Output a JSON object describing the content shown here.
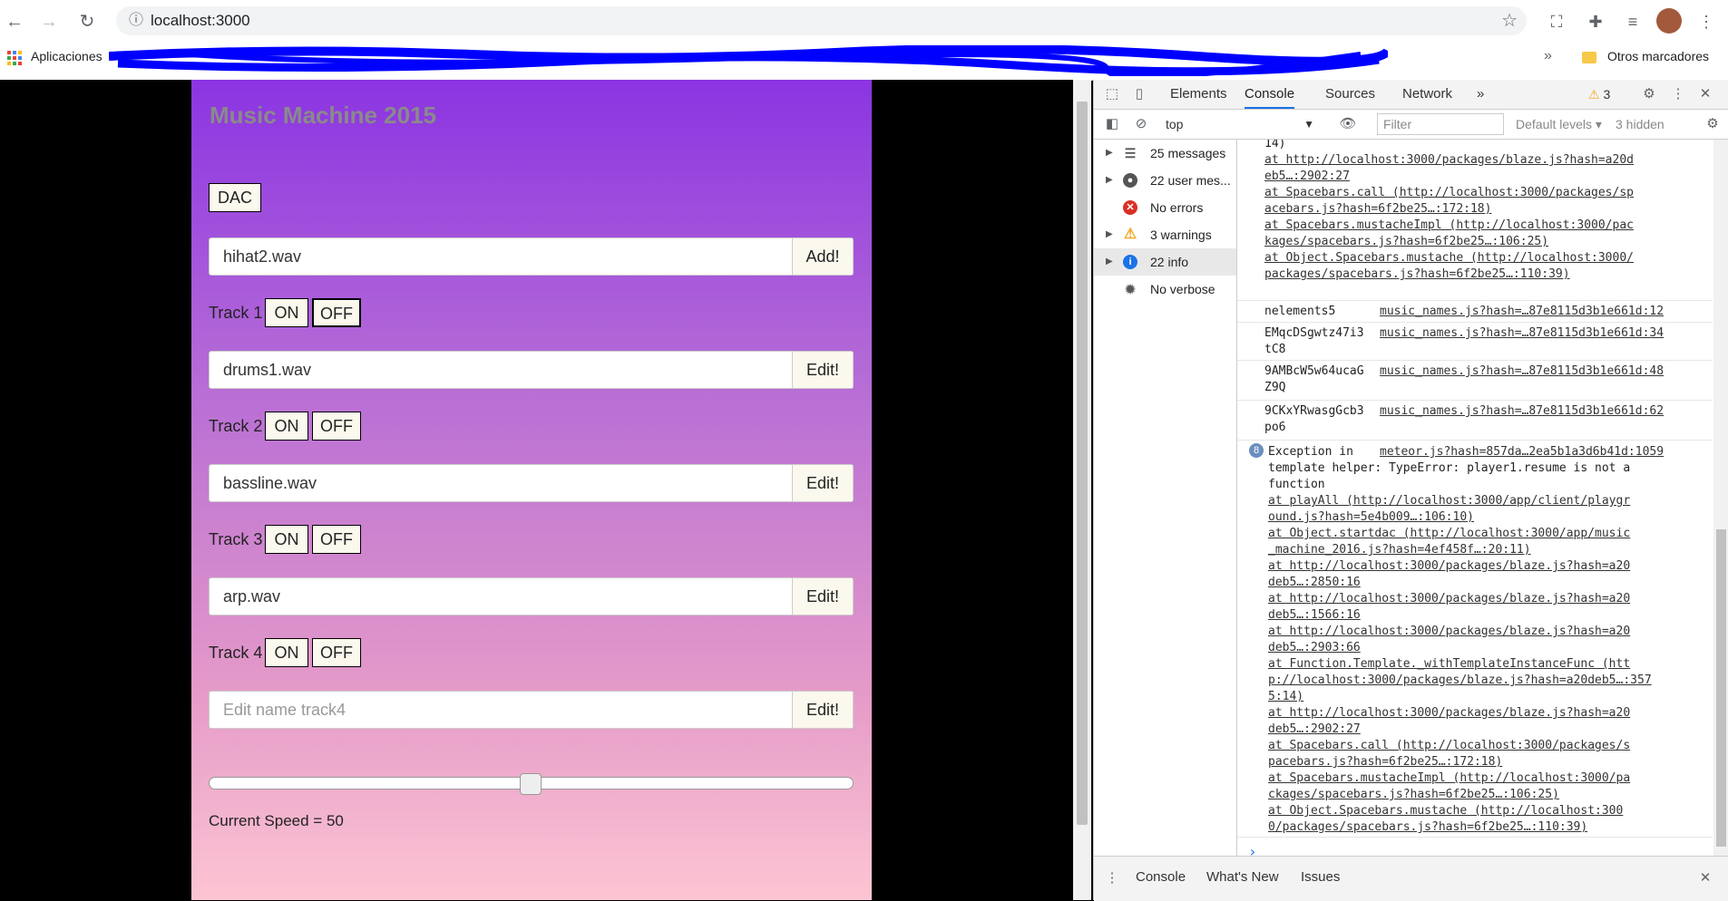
{
  "browser": {
    "url": "localhost:3000",
    "bookmarks": {
      "apps_label": "Aplicaciones",
      "more": "»",
      "other_label": "Otros marcadores"
    }
  },
  "app": {
    "title": "Music Machine 2015",
    "dac_label": "DAC",
    "rows": [
      {
        "input_value": "hihat2.wav",
        "placeholder": "",
        "action": "Add!"
      },
      {
        "input_value": "drums1.wav",
        "placeholder": "",
        "action": "Edit!"
      },
      {
        "input_value": "bassline.wav",
        "placeholder": "",
        "action": "Edit!"
      },
      {
        "input_value": "arp.wav",
        "placeholder": "",
        "action": "Edit!"
      },
      {
        "input_value": "",
        "placeholder": "Edit name track4",
        "action": "Edit!"
      }
    ],
    "tracks": [
      {
        "label": "Track 1",
        "on": "ON",
        "off": "OFF",
        "off_active": true
      },
      {
        "label": "Track 2",
        "on": "ON",
        "off": "OFF",
        "off_active": false
      },
      {
        "label": "Track 3",
        "on": "ON",
        "off": "OFF",
        "off_active": false
      },
      {
        "label": "Track 4",
        "on": "ON",
        "off": "OFF",
        "off_active": false
      }
    ],
    "speed_value": 50,
    "speed_text": "Current Speed = 50"
  },
  "devtools": {
    "tabs": [
      "Elements",
      "Console",
      "Sources",
      "Network"
    ],
    "active_tab": "Console",
    "more_tabs": "»",
    "warning_count": "3",
    "context": "top",
    "filter_placeholder": "Filter",
    "levels": "Default levels ▾",
    "hidden": "3 hidden",
    "sidebar": [
      {
        "label": "25 messages",
        "icon": "list-icon",
        "expandable": true
      },
      {
        "label": "22 user mes...",
        "icon": "user-icon",
        "expandable": true
      },
      {
        "label": "No errors",
        "icon": "error-icon",
        "expandable": false
      },
      {
        "label": "3 warnings",
        "icon": "warning-icon",
        "expandable": true
      },
      {
        "label": "22 info",
        "icon": "info-icon",
        "expandable": true
      },
      {
        "label": "No verbose",
        "icon": "bug-icon",
        "expandable": false
      }
    ],
    "console_top_lines": [
      "14)",
      "    at http://localhost:3000/packages/blaze.js?hash=a20d",
      "eb5…:2902:27",
      "    at Spacebars.call (http://localhost:3000/packages/sp",
      "acebars.js?hash=6f2be25…:172:18)",
      "    at Spacebars.mustacheImpl (http://localhost:3000/pac",
      "kages/spacebars.js?hash=6f2be25…:106:25)",
      "    at Object.Spacebars.mustache (http://localhost:3000/",
      "packages/spacebars.js?hash=6f2be25…:110:39)"
    ],
    "log_messages": [
      {
        "lines": [
          "nelements5"
        ],
        "source": "music_names.js?hash=…87e8115d3b1e661d:12"
      },
      {
        "lines": [
          "EMqcDSgwtz47i3",
          "tC8"
        ],
        "source": "music_names.js?hash=…87e8115d3b1e661d:34"
      },
      {
        "lines": [
          "9AMBcW5w64ucaG",
          "Z9Q"
        ],
        "source": "music_names.js?hash=…87e8115d3b1e661d:48"
      },
      {
        "lines": [
          "9CKxYRwasgGcb3",
          "po6"
        ],
        "source": "music_names.js?hash=…87e8115d3b1e661d:62"
      }
    ],
    "exception": {
      "count": "8",
      "source": "meteor.js?hash=857da…2ea5b1a3d6b41d:1059",
      "lines": [
        "Exception in",
        "template helper: TypeError: player1.resume is not a",
        "function",
        "    at playAll (http://localhost:3000/app/client/playgr",
        "ound.js?hash=5e4b009…:106:10)",
        "    at Object.startdac (http://localhost:3000/app/music",
        "_machine_2016.js?hash=4ef458f…:20:11)",
        "    at http://localhost:3000/packages/blaze.js?hash=a20",
        "deb5…:2850:16",
        "    at http://localhost:3000/packages/blaze.js?hash=a20",
        "deb5…:1566:16",
        "    at http://localhost:3000/packages/blaze.js?hash=a20",
        "deb5…:2903:66",
        "    at Function.Template._withTemplateInstanceFunc (htt",
        "p://localhost:3000/packages/blaze.js?hash=a20deb5…:357",
        "5:14)",
        "    at http://localhost:3000/packages/blaze.js?hash=a20",
        "deb5…:2902:27",
        "    at Spacebars.call (http://localhost:3000/packages/s",
        "pacebars.js?hash=6f2be25…:172:18)",
        "    at Spacebars.mustacheImpl (http://localhost:3000/pa",
        "ckages/spacebars.js?hash=6f2be25…:106:25)",
        "    at Object.Spacebars.mustache (http://localhost:300",
        "0/packages/spacebars.js?hash=6f2be25…:110:39)"
      ]
    },
    "prompt": "›",
    "drawer_tabs": [
      "Console",
      "What's New",
      "Issues"
    ]
  }
}
